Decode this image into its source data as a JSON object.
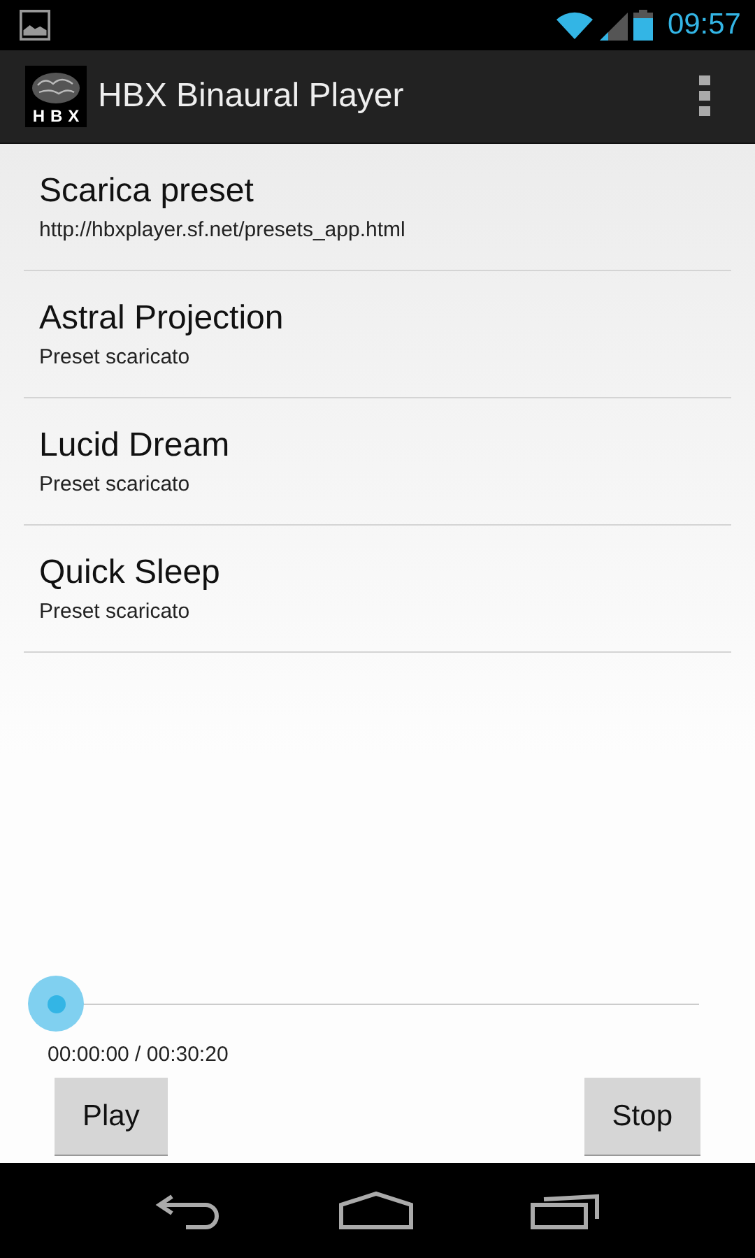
{
  "status_bar": {
    "time": "09:57"
  },
  "action_bar": {
    "logo_text": "HBX",
    "title": "HBX Binaural Player"
  },
  "presets": [
    {
      "title": "Scarica preset",
      "subtitle": "http://hbxplayer.sf.net/presets_app.html"
    },
    {
      "title": "Astral Projection",
      "subtitle": "Preset scaricato"
    },
    {
      "title": "Lucid Dream",
      "subtitle": "Preset scaricato"
    },
    {
      "title": "Quick Sleep",
      "subtitle": "Preset scaricato"
    }
  ],
  "player": {
    "time": "00:00:00 / 00:30:20",
    "buttons": [
      "Play",
      "Stop"
    ]
  }
}
